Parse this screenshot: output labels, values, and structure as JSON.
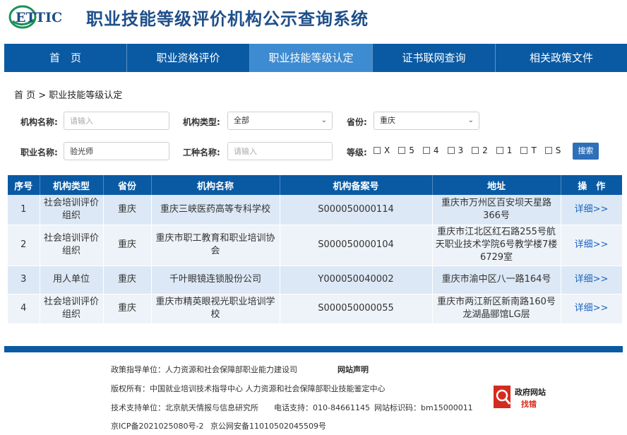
{
  "header": {
    "logo_text": "ETTIC",
    "title": "职业技能等级评价机构公示查询系统"
  },
  "nav": {
    "items": [
      {
        "label": "首　页"
      },
      {
        "label": "职业资格评价"
      },
      {
        "label": "职业技能等级认定"
      },
      {
        "label": "证书联网查询"
      },
      {
        "label": "相关政策文件"
      }
    ],
    "active_index": 2
  },
  "breadcrumb": "首 页 > 职业技能等级认定",
  "filters": {
    "org_name": {
      "label": "机构名称:",
      "value": "",
      "placeholder": "请输入"
    },
    "org_type": {
      "label": "机构类型:",
      "selected": "全部"
    },
    "province": {
      "label": "省份:",
      "selected": "重庆"
    },
    "occupation": {
      "label": "职业名称:",
      "value": "验光师",
      "placeholder": "请输入"
    },
    "job_type": {
      "label": "工种名称:",
      "value": "",
      "placeholder": "请输入"
    },
    "level": {
      "label": "等级:",
      "options": [
        "X",
        "5",
        "4",
        "3",
        "2",
        "1",
        "T",
        "S"
      ]
    },
    "search_label": "搜索"
  },
  "table": {
    "columns": [
      "序号",
      "机构类型",
      "省份",
      "机构名称",
      "机构备案号",
      "地址",
      "操　作"
    ],
    "rows": [
      {
        "no": "1",
        "type": "社会培训评价组织",
        "province": "重庆",
        "name": "重庆三峡医药高等专科学校",
        "record": "S000050000114",
        "address": "重庆市万州区百安坝天星路366号",
        "action": "详细>>"
      },
      {
        "no": "2",
        "type": "社会培训评价组织",
        "province": "重庆",
        "name": "重庆市职工教育和职业培训协会",
        "record": "S000050000104",
        "address": "重庆市江北区红石路255号航天职业技术学院6号教学楼7楼6729室",
        "action": "详细>>"
      },
      {
        "no": "3",
        "type": "用人单位",
        "province": "重庆",
        "name": "千叶眼镜连锁股份公司",
        "record": "Y000050040002",
        "address": "重庆市渝中区八一路164号",
        "action": "详细>>"
      },
      {
        "no": "4",
        "type": "社会培训评价组织",
        "province": "重庆",
        "name": "重庆市精英眼视光职业培训学校",
        "record": "S000050000055",
        "address": "重庆市两江新区新南路160号龙湖晶郦馆LG层",
        "action": "详细>>"
      }
    ]
  },
  "footer": {
    "guidance": "政策指导单位：人力资源和社会保障部职业能力建设司",
    "statement": "网站声明",
    "copyright": "版权所有：中国就业培训技术指导中心 人力资源和社会保障部职业技能鉴定中心",
    "support_unit": "技术支持单位：北京航天情报与信息研究所",
    "phone": "电话支持：010-84661145",
    "site_code": "网站标识码：bm15000011",
    "icp": "京ICP备2021025080号-2",
    "police": "京公网安备11010502045509号",
    "gov_badge_line1": "政府网站",
    "gov_badge_line2": "找错"
  },
  "colors": {
    "nav_bg": "#0a5aa3",
    "nav_active": "#3d8bd0",
    "title": "#1e4f8a",
    "link": "#1b64c0",
    "row_odd": "#dce8f5",
    "row_even": "#eef3f9"
  }
}
